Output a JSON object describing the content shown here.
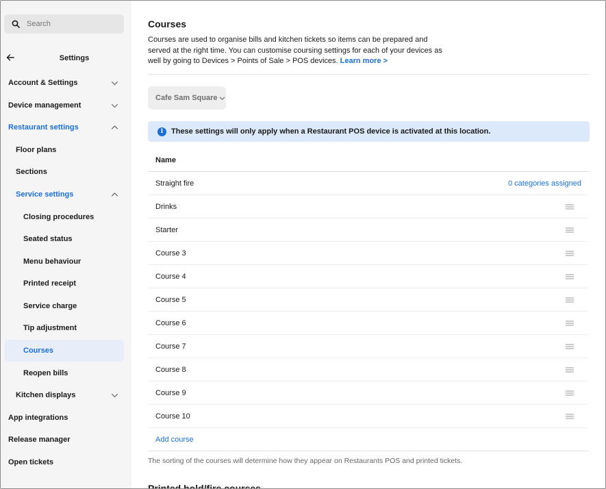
{
  "search": {
    "placeholder": "Search",
    "icon": "search-icon"
  },
  "sidebar": {
    "title": "Settings",
    "items": [
      {
        "label": "Account & Settings",
        "chevron": "down"
      },
      {
        "label": "Device management",
        "chevron": "down"
      },
      {
        "label": "Restaurant settings",
        "chevron": "up",
        "state": "active"
      },
      {
        "label": "Floor plans"
      },
      {
        "label": "Sections"
      },
      {
        "label": "Service settings",
        "chevron": "up",
        "state": "active"
      },
      {
        "label": "Closing procedures"
      },
      {
        "label": "Seated status"
      },
      {
        "label": "Menu behaviour"
      },
      {
        "label": "Printed receipt"
      },
      {
        "label": "Service charge"
      },
      {
        "label": "Tip adjustment"
      },
      {
        "label": "Courses",
        "state": "selected"
      },
      {
        "label": "Reopen bills"
      },
      {
        "label": "Kitchen displays",
        "chevron": "down"
      },
      {
        "label": "App integrations"
      },
      {
        "label": "Release manager"
      },
      {
        "label": "Open tickets"
      }
    ]
  },
  "main": {
    "title": "Courses",
    "description": "Courses are used to organise bills and kitchen tickets so items can be prepared and served at the right time. You can customise coursing settings for each of your devices as well by going to Devices > Points of Sale > POS devices.",
    "learn_more": "Learn more >",
    "location": "Cafe Sam Square",
    "banner": "These settings will only apply when a Restaurant POS device is activated at this location.",
    "table_header": "Name",
    "courses": [
      {
        "name": "Straight fire",
        "assigned": "0 categories assigned"
      },
      {
        "name": "Drinks"
      },
      {
        "name": "Starter"
      },
      {
        "name": "Course 3"
      },
      {
        "name": "Course 4"
      },
      {
        "name": "Course 5"
      },
      {
        "name": "Course 6"
      },
      {
        "name": "Course 7"
      },
      {
        "name": "Course 8"
      },
      {
        "name": "Course 9"
      },
      {
        "name": "Course 10"
      }
    ],
    "add_course": "Add course",
    "note": "The sorting of the courses will determine how they appear on Restaurants POS and printed tickets.",
    "next_section_title": "Printed hold/fire courses"
  },
  "colors": {
    "accent": "#1a6fdb",
    "sidebar_bg": "#f5f5f5",
    "banner_bg": "#dce9fa",
    "selected_bg": "#e7eef9"
  }
}
